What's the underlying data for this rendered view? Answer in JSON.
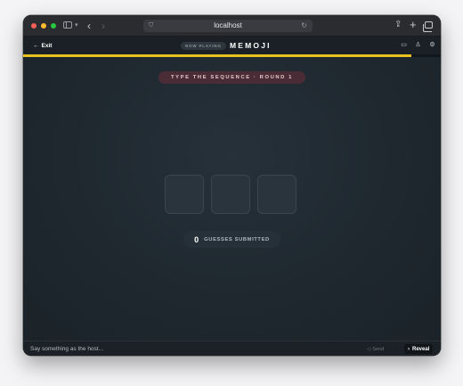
{
  "browser": {
    "url": "localhost",
    "icons": [
      "sidebar-toggle-icon",
      "chevron-down-icon",
      "back-icon",
      "forward-icon",
      "shield-icon",
      "reload-icon",
      "share-icon",
      "plus-icon",
      "tabs-icon"
    ]
  },
  "header": {
    "exit_label": "Exit",
    "now_playing_label": "NOW PLAYING",
    "game_title": "MEMOJI",
    "icons": [
      "display-icon",
      "person-icon",
      "gear-icon"
    ]
  },
  "progress": {
    "fraction": 0.93,
    "color": "#e9c21d"
  },
  "main": {
    "round_label": "TYPE THE SEQUENCE · ROUND 1",
    "slot_count": 3,
    "guess_count": "0",
    "guess_label": "GUESSES SUBMITTED"
  },
  "chat": {
    "placeholder": "Say something as the host...",
    "send_label": "Send",
    "reveal_label": "Reveal"
  },
  "colors": {
    "accent": "#e9c21d",
    "round_pill": "#4a2c36",
    "background": "#1f272e"
  }
}
